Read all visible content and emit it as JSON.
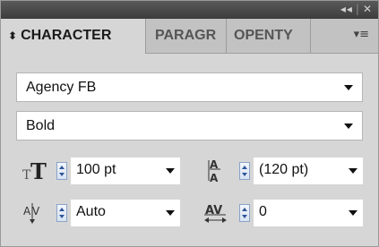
{
  "window": {
    "controls": [
      "◂◂",
      "✕"
    ]
  },
  "tabs": [
    {
      "label": "CHARACTER",
      "active": true
    },
    {
      "label": "PARAGR",
      "active": false
    },
    {
      "label": "OPENTY",
      "active": false
    }
  ],
  "panel_menu_icon": "▾≡",
  "font_family": {
    "value": "Agency FB"
  },
  "font_style": {
    "value": "Bold"
  },
  "font_size": {
    "value": "100 pt",
    "icon": "font-size-icon"
  },
  "leading": {
    "value": "(120 pt)",
    "icon": "leading-icon"
  },
  "kerning": {
    "value": "Auto",
    "icon": "kerning-icon"
  },
  "tracking": {
    "value": "0",
    "icon": "tracking-icon"
  },
  "colors": {
    "title_bar": "#3c3c3c",
    "panel_bg": "#d6d6d6",
    "stepper_arrow": "#2f5597"
  }
}
